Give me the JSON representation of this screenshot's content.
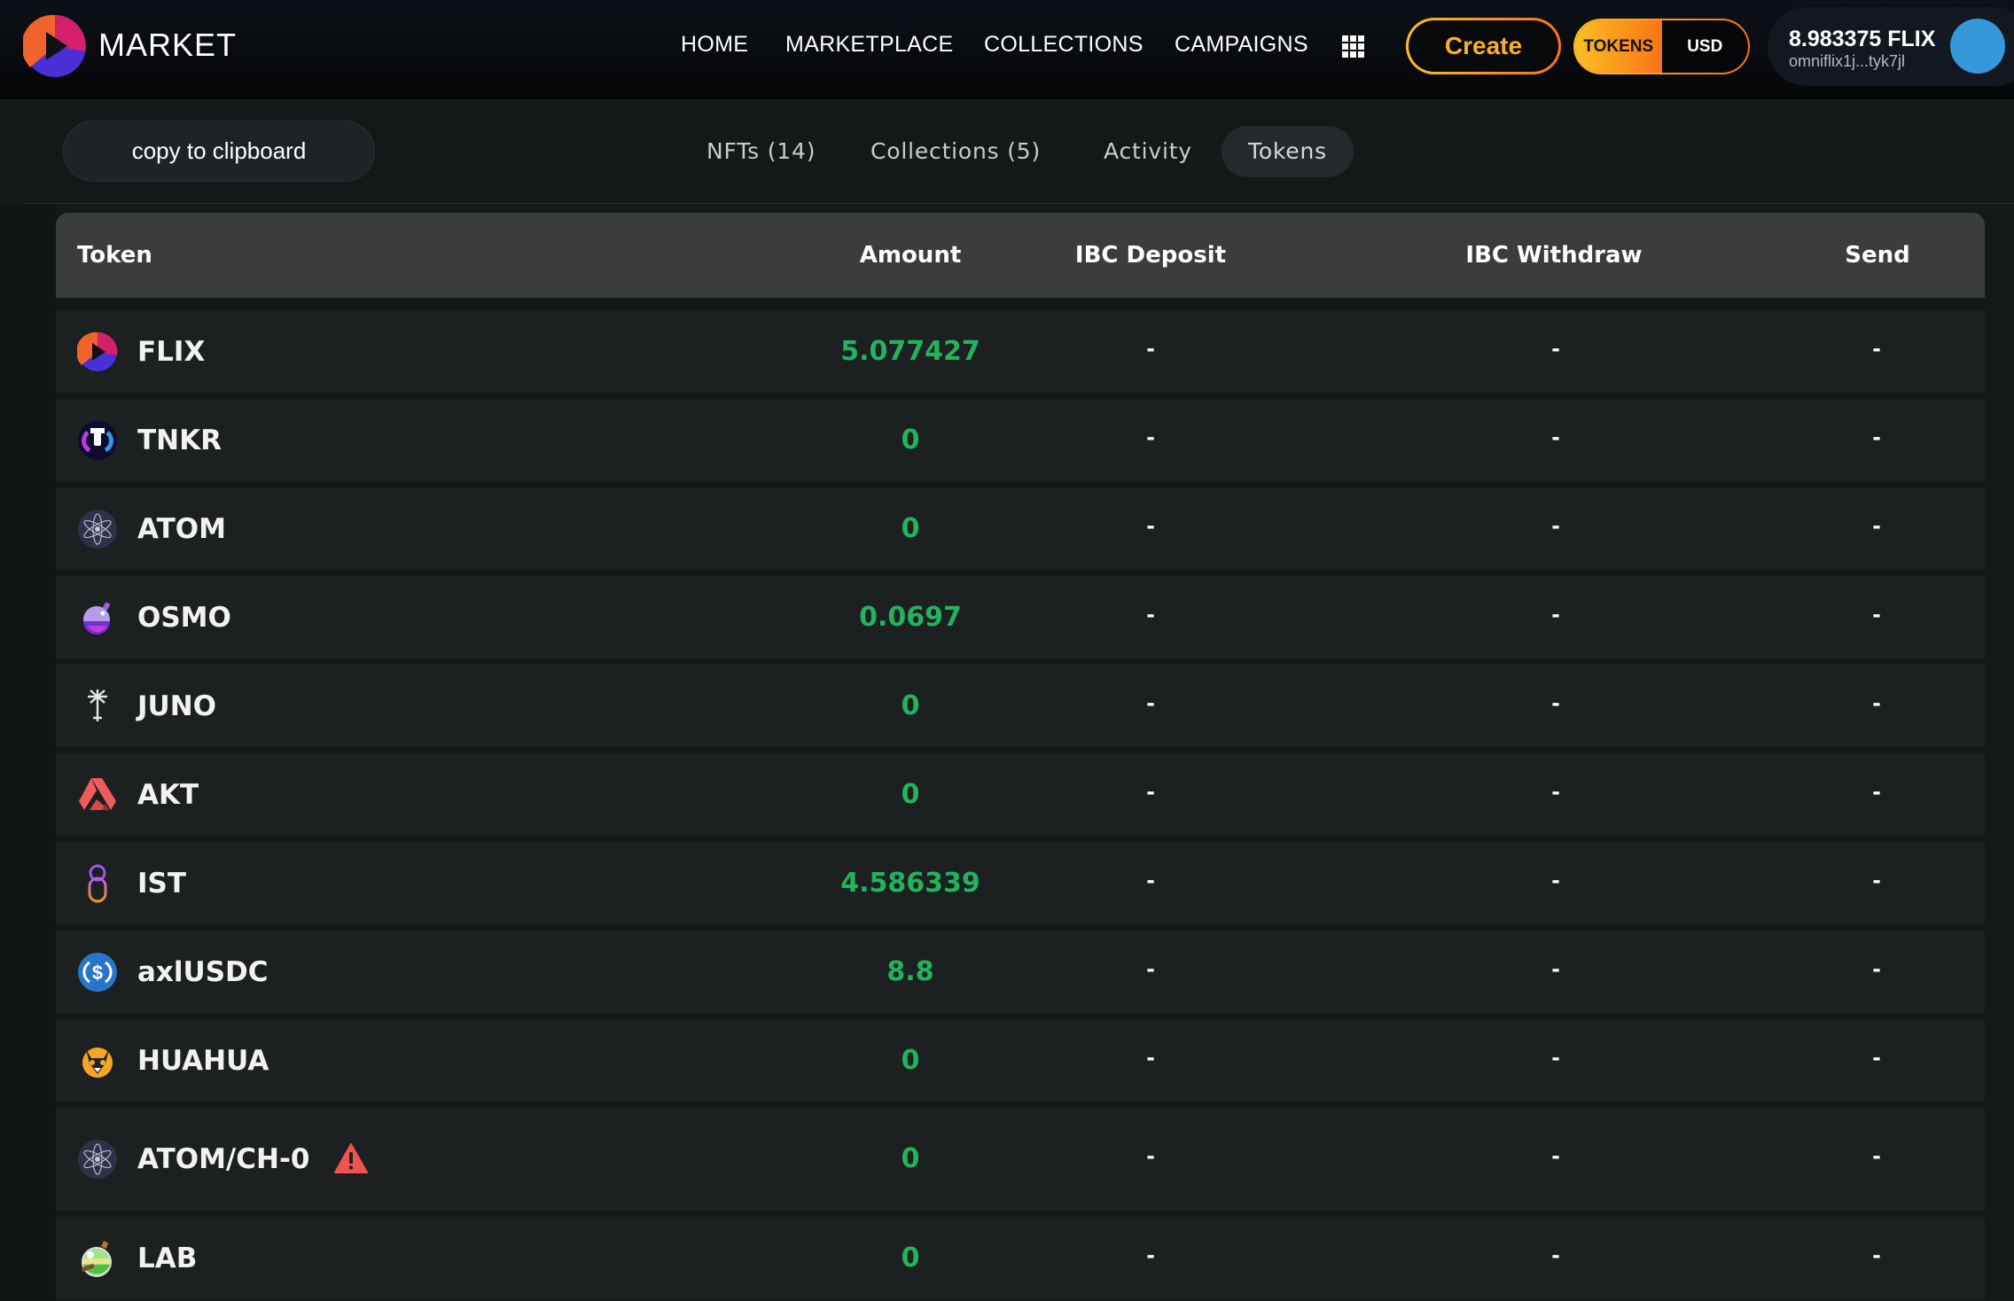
{
  "header": {
    "brand": "MARKET",
    "nav": [
      {
        "label": "HOME"
      },
      {
        "label": "MARKETPLACE"
      },
      {
        "label": "COLLECTIONS"
      },
      {
        "label": "CAMPAIGNS"
      }
    ],
    "apps_icon": "grid-icon",
    "create_label": "Create",
    "currency_toggle": {
      "options": [
        "TOKENS",
        "USD"
      ],
      "selected": "TOKENS"
    },
    "wallet": {
      "balance": "8.983375 FLIX",
      "address": "omniflix1j...tyk7jl"
    },
    "colors": {
      "accent_start": "#fbbf24",
      "accent_end": "#f97316",
      "avatar": "#3498db"
    }
  },
  "profile": {
    "copy_label": "copy to clipboard",
    "tabs": [
      {
        "label": "NFTs (14)",
        "active": false
      },
      {
        "label": "Collections (5)",
        "active": false
      },
      {
        "label": "Activity",
        "active": false
      },
      {
        "label": "Tokens",
        "active": true
      }
    ]
  },
  "table": {
    "columns": [
      "Token",
      "Amount",
      "IBC Deposit",
      "IBC Withdraw",
      "Send"
    ],
    "amount_color": "#22b35e",
    "rows": [
      {
        "symbol": "FLIX",
        "icon": "flix-icon",
        "amount": "5.077427",
        "ibc_deposit": "-",
        "ibc_withdraw": "-",
        "send": "-",
        "warning": false
      },
      {
        "symbol": "TNKR",
        "icon": "tnkr-icon",
        "amount": "0",
        "ibc_deposit": "-",
        "ibc_withdraw": "-",
        "send": "-",
        "warning": false
      },
      {
        "symbol": "ATOM",
        "icon": "atom-icon",
        "amount": "0",
        "ibc_deposit": "-",
        "ibc_withdraw": "-",
        "send": "-",
        "warning": false
      },
      {
        "symbol": "OSMO",
        "icon": "osmo-icon",
        "amount": "0.0697",
        "ibc_deposit": "-",
        "ibc_withdraw": "-",
        "send": "-",
        "warning": false
      },
      {
        "symbol": "JUNO",
        "icon": "juno-icon",
        "amount": "0",
        "ibc_deposit": "-",
        "ibc_withdraw": "-",
        "send": "-",
        "warning": false
      },
      {
        "symbol": "AKT",
        "icon": "akt-icon",
        "amount": "0",
        "ibc_deposit": "-",
        "ibc_withdraw": "-",
        "send": "-",
        "warning": false
      },
      {
        "symbol": "IST",
        "icon": "ist-icon",
        "amount": "4.586339",
        "ibc_deposit": "-",
        "ibc_withdraw": "-",
        "send": "-",
        "warning": false
      },
      {
        "symbol": "axlUSDC",
        "icon": "usdc-icon",
        "amount": "8.8",
        "ibc_deposit": "-",
        "ibc_withdraw": "-",
        "send": "-",
        "warning": false
      },
      {
        "symbol": "HUAHUA",
        "icon": "huahua-icon",
        "amount": "0",
        "ibc_deposit": "-",
        "ibc_withdraw": "-",
        "send": "-",
        "warning": false
      },
      {
        "symbol": "ATOM/CH-0",
        "icon": "atom-icon",
        "amount": "0",
        "ibc_deposit": "-",
        "ibc_withdraw": "-",
        "send": "-",
        "warning": true
      },
      {
        "symbol": "LAB",
        "icon": "lab-icon",
        "amount": "0",
        "ibc_deposit": "-",
        "ibc_withdraw": "-",
        "send": "-",
        "warning": false
      }
    ]
  }
}
